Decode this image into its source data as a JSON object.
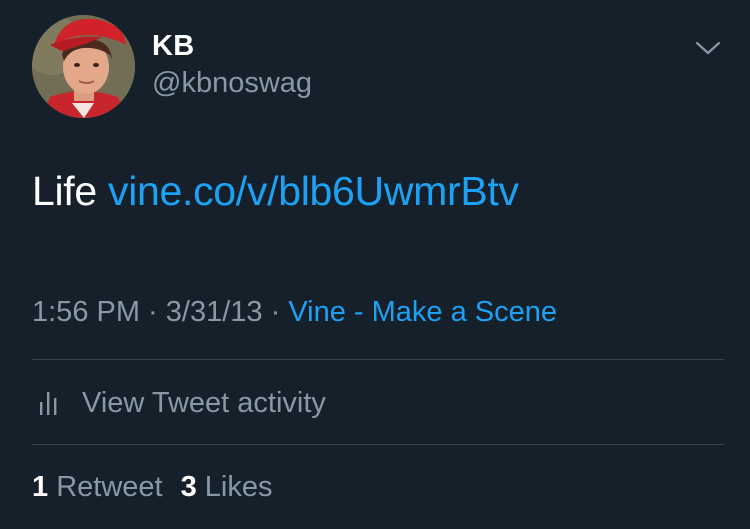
{
  "user": {
    "display_name": "KB",
    "handle": "@kbnoswag",
    "avatar_icon": "profile-photo"
  },
  "tweet": {
    "text": "Life ",
    "link": "vine.co/v/blb6UwmrBtv"
  },
  "meta": {
    "time": "1:56 PM",
    "separator1": " · ",
    "date": "3/31/13",
    "separator2": " · ",
    "source": "Vine - Make a Scene"
  },
  "activity": {
    "label": "View Tweet activity",
    "icon": "bar-chart-icon"
  },
  "stats": {
    "retweets_count": "1",
    "retweets_label": "Retweet",
    "likes_count": "3",
    "likes_label": "Likes"
  },
  "colors": {
    "background": "#15202b",
    "link": "#1da1f2",
    "secondary_text": "#8899a6",
    "divider": "#38444d"
  }
}
